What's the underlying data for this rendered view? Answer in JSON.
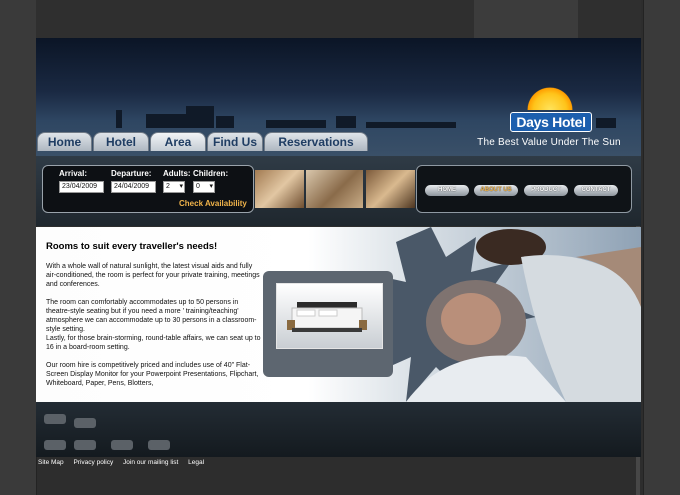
{
  "nav": {
    "tabs": [
      {
        "label": "Home"
      },
      {
        "label": "Hotel"
      },
      {
        "label": "Area"
      },
      {
        "label": "Find Us"
      },
      {
        "label": "Reservations"
      }
    ]
  },
  "logo": {
    "name": "Days Hotel",
    "tagline": "The Best Value Under The Sun"
  },
  "booking": {
    "arrival_label": "Arrival:",
    "arrival_value": "23/04/2009",
    "departure_label": "Departure:",
    "departure_value": "24/04/2009",
    "adults_label": "Adults:",
    "adults_value": "2",
    "children_label": "Children:",
    "children_value": "0",
    "check_label": "Check Availability"
  },
  "menu": {
    "items": [
      {
        "label": "HOME"
      },
      {
        "label": "ABOUT US"
      },
      {
        "label": "PRODUCT"
      },
      {
        "label": "CONTACT"
      }
    ]
  },
  "content": {
    "heading": "Rooms to suit every traveller's needs!",
    "p1": "With a whole wall of natural sunlight, the latest visual aids and fully air-conditioned, the room is perfect for your private training, meetings and conferences.",
    "p2": "The room can comfortably accommodates up to 50 persons in theatre-style seating but if you need a more ' training/teaching' atmosphere we can accommodate up to 30 persons in a classroom-style setting.",
    "p3": "Lastly, for those brain-storming, round-table affairs, we can seat up to 16 in a board-room setting.",
    "p4": "Our room hire is competitively priced and includes use of 40\" Flat-Screen Display Monitor for your Powerpoint Presentations, Flipchart, Whiteboard, Paper, Pens, Blotters,"
  },
  "footer": {
    "links": [
      {
        "label": "Site Map"
      },
      {
        "label": "Privacy policy"
      },
      {
        "label": "Join our mailing list"
      },
      {
        "label": "Legal"
      }
    ]
  },
  "colors": {
    "brand_blue": "#1c5fae",
    "accent_orange": "#f0b34a",
    "tab_text": "#1f3d63"
  }
}
